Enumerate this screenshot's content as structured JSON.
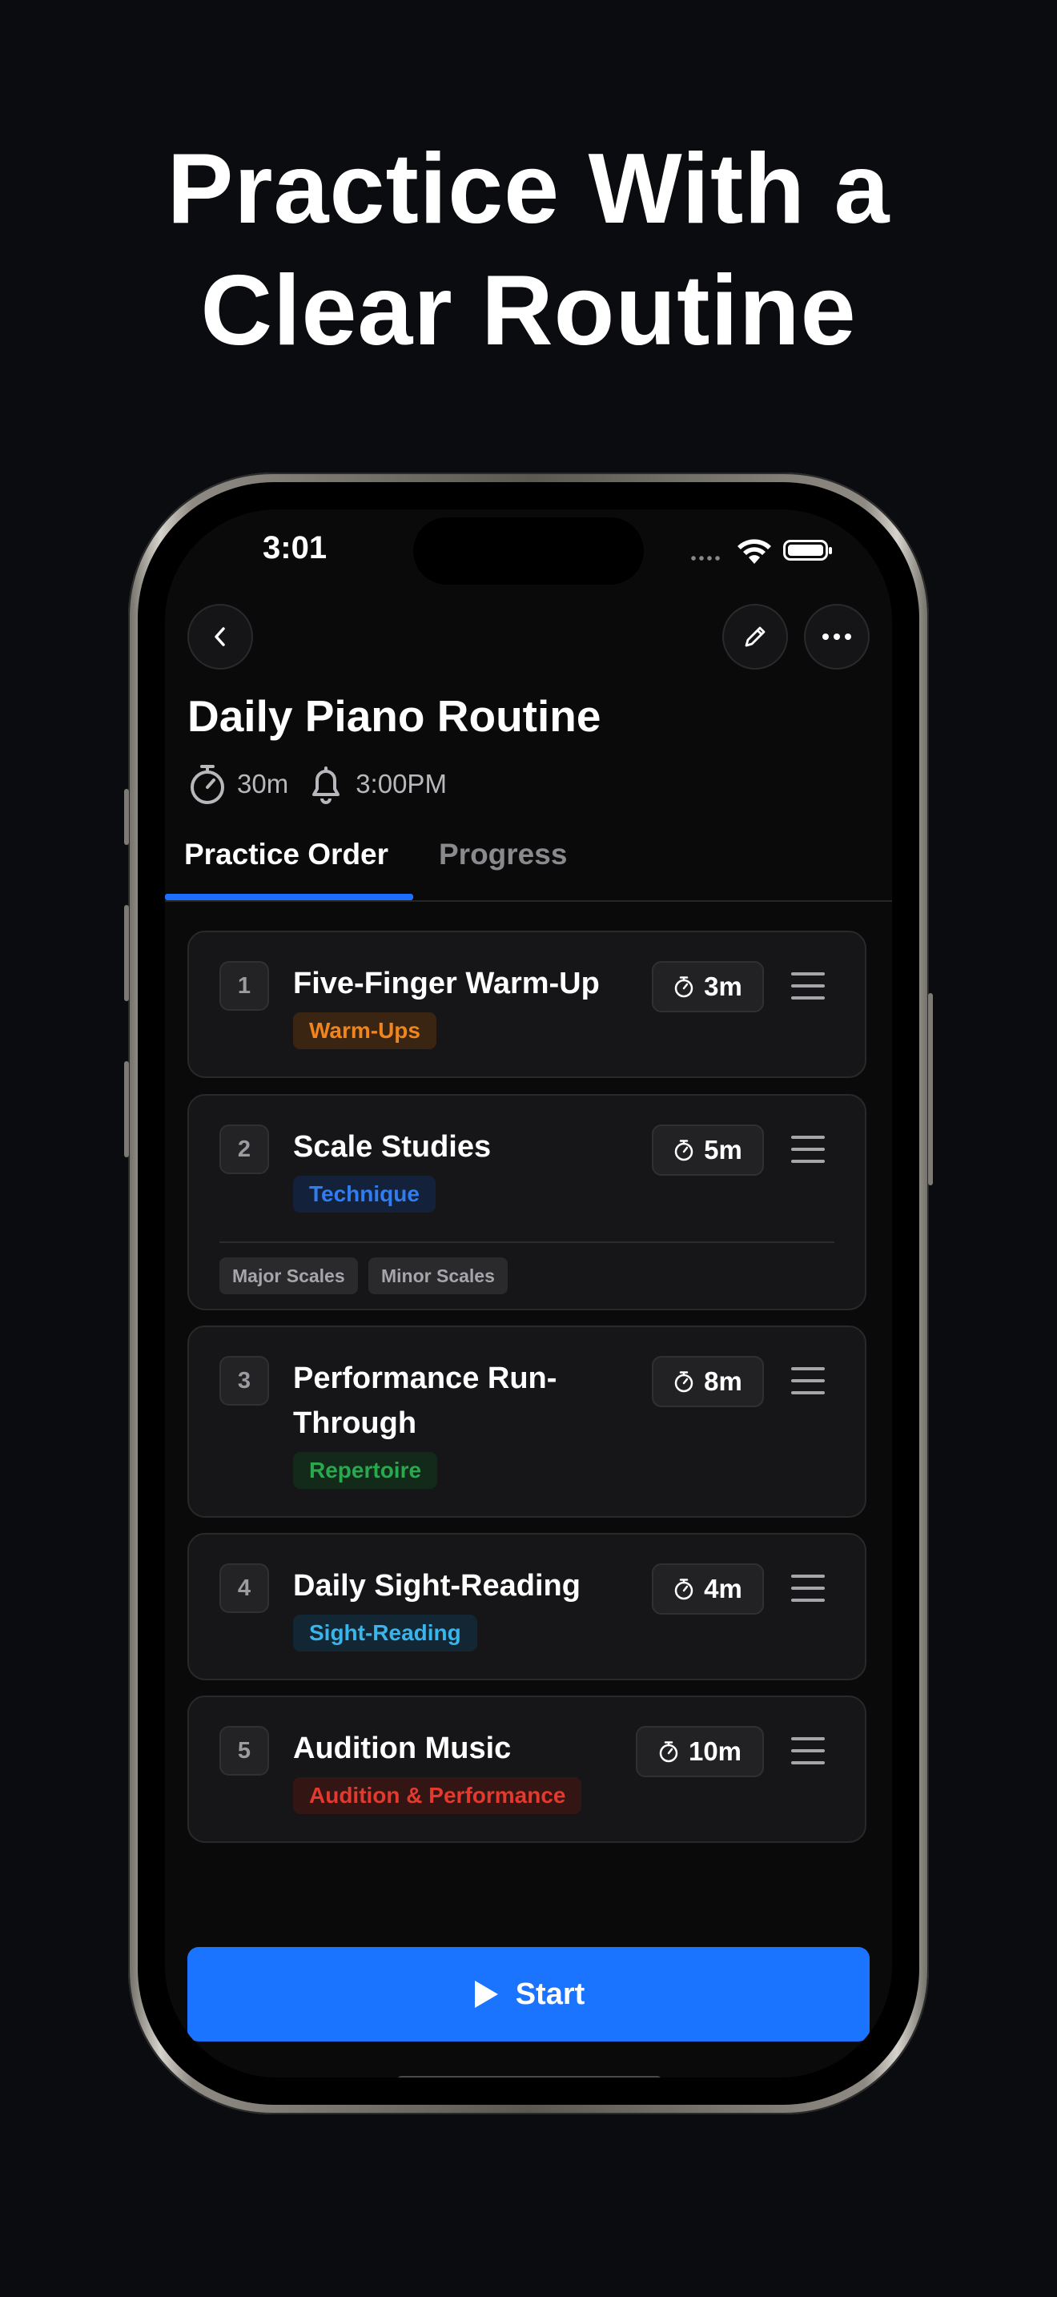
{
  "headline": {
    "line1": "Practice With a",
    "line2": "Clear Routine"
  },
  "status_bar": {
    "time": "3:01"
  },
  "routine": {
    "title": "Daily Piano Routine",
    "duration": "30m",
    "reminder": "3:00PM"
  },
  "tabs": [
    {
      "label": "Practice Order",
      "active": true
    },
    {
      "label": "Progress",
      "active": false
    }
  ],
  "items": [
    {
      "number": "1",
      "title": "Five-Finger Warm-Up",
      "category": "Warm-Ups",
      "category_color": "#f0851e",
      "duration": "3m"
    },
    {
      "number": "2",
      "title": "Scale Studies",
      "category": "Technique",
      "category_color": "#2f7df0",
      "duration": "5m",
      "tags": [
        "Major Scales",
        "Minor Scales"
      ]
    },
    {
      "number": "3",
      "title": "Performance Run-Through",
      "category": "Repertoire",
      "category_color": "#2aa84f",
      "duration": "8m"
    },
    {
      "number": "4",
      "title": "Daily Sight-Reading",
      "category": "Sight-Reading",
      "category_color": "#3ab4ea",
      "duration": "4m"
    },
    {
      "number": "5",
      "title": "Audition Music",
      "category": "Audition & Performance",
      "category_color": "#e23a2e",
      "duration": "10m"
    }
  ],
  "start_button": {
    "label": "Start"
  },
  "colors": {
    "accent": "#1b74ff",
    "background": "#0b0c10",
    "card": "#161618"
  }
}
